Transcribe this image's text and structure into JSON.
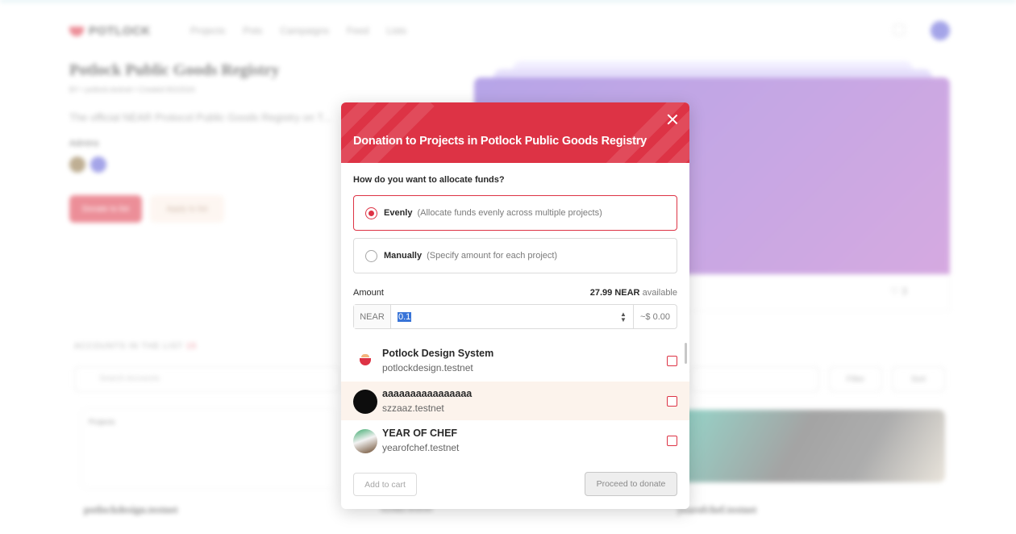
{
  "background": {
    "logo_text": "POTLOCK",
    "nav": [
      "Projects",
      "Pots",
      "Campaigns",
      "Feed",
      "Lists"
    ],
    "title": "Potlock Public Goods Registry",
    "subtitle": "BY  • potlock.testnet • Created 8/2/2024",
    "description": "The official NEAR Protocol Public Goods Registry on T...",
    "admins_label": "Admins",
    "donate_button": "Donate to list",
    "apply_button": "Apply to list",
    "likes": "3",
    "accounts_heading": "ACCOUNTS IN THE LIST",
    "accounts_count": "15",
    "search_placeholder": "Search Accounts",
    "filter_label": "Filter",
    "sort_label": "Sort",
    "card1_label": "Projects",
    "card_names": [
      "potlockdesign.testnet",
      "szzaaz.testnet",
      "yearofchef.testnet"
    ]
  },
  "modal": {
    "title": "Donation to Projects in Potlock Public Goods Registry",
    "question": "How do you want to allocate funds?",
    "options": [
      {
        "label": "Evenly",
        "hint": "(Allocate funds evenly across multiple projects)",
        "selected": true
      },
      {
        "label": "Manually",
        "hint": "(Specify amount for each project)",
        "selected": false
      }
    ],
    "amount_label": "Amount",
    "balance_value": "27.99 NEAR",
    "balance_suffix": "available",
    "currency": "NEAR",
    "amount_value": "0.1",
    "usd_value": "~$ 0.00",
    "projects": [
      {
        "name": "Potlock Design System",
        "account": "potlockdesign.testnet",
        "checked": false
      },
      {
        "name": "aaaaaaaaaaaaaaaa",
        "account": "szzaaz.testnet",
        "checked": false
      },
      {
        "name": "YEAR OF CHEF",
        "account": "yearofchef.testnet",
        "checked": false
      }
    ],
    "add_to_cart": "Add to cart",
    "proceed": "Proceed to donate"
  },
  "colors": {
    "accent": "#dd3345",
    "highlight_row": "#fcf3ec",
    "banner": "#9b6bd0"
  }
}
